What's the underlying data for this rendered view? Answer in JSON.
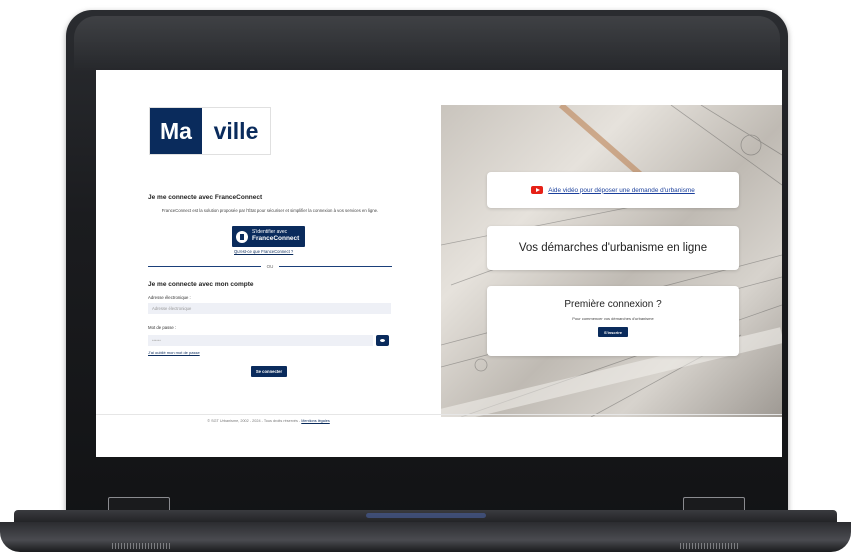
{
  "brand": {
    "part1": "Ma",
    "part2": "ville"
  },
  "franceconnect": {
    "title": "Je me connecte avec FranceConnect",
    "description": "FranceConnect est la solution proposée par l'État pour sécuriser et simplifier la connexion à vos services en ligne.",
    "button_line1": "S'identifier avec",
    "button_line2": "FranceConnect",
    "link": "Qu'est-ce que FranceConnect ?"
  },
  "separator": "OU",
  "account": {
    "title": "Je me connecte avec mon compte",
    "email_label": "Adresse électronique :",
    "email_placeholder": "Adresse électronique",
    "password_label": "Mot de passe :",
    "password_placeholder": "••••••",
    "forgot_link": "J'ai oublié mon mot de passe",
    "login_button": "Se connecter"
  },
  "footer": {
    "text": "© SGT Urbanisme, 2002 - 2024 - Tous droits réservés -",
    "legal_link": "Mentions légales"
  },
  "right_panel": {
    "video_link": "Aide vidéo pour déposer une demande d'urbanisme",
    "headline": "Vos démarches d'urbanisme en ligne",
    "first_title": "Première connexion ?",
    "first_sub": "Pour commencer vos démarches d'urbanisme",
    "signup_button": "S'inscrire"
  },
  "colors": {
    "brand_navy": "#0a2b5c",
    "youtube_red": "#e62117",
    "link_blue": "#1a3f9c"
  }
}
